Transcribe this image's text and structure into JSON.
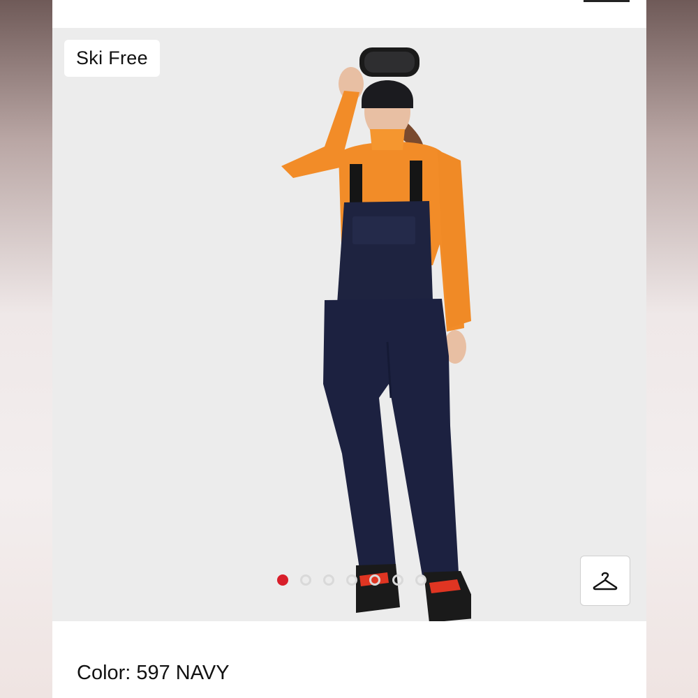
{
  "gallery": {
    "badge": "Ski Free",
    "dots": {
      "count": 7,
      "active_index": 0
    },
    "accent_color": "#d81e2a",
    "size_icon": "hanger-icon"
  },
  "product": {
    "color_label": "Color:",
    "color_value": "597 NAVY"
  }
}
